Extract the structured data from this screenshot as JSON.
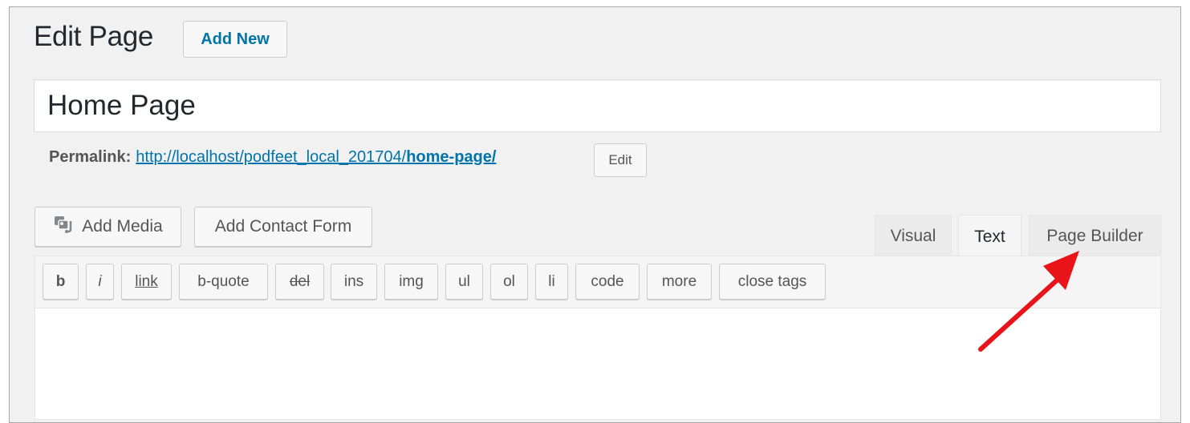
{
  "header": {
    "title": "Edit Page",
    "add_new": "Add New"
  },
  "post": {
    "title": "Home Page"
  },
  "permalink": {
    "label": "Permalink:",
    "url_base": "http://localhost/podfeet_local_201704/",
    "url_slug": "home-page/",
    "edit_label": "Edit"
  },
  "media": {
    "add_media": "Add Media",
    "add_contact_form": "Add Contact Form"
  },
  "tabs": [
    {
      "label": "Visual",
      "active": false
    },
    {
      "label": "Text",
      "active": true
    },
    {
      "label": "Page Builder",
      "active": false
    }
  ],
  "quicktags": [
    "b",
    "i",
    "link",
    "b-quote",
    "del",
    "ins",
    "img",
    "ul",
    "ol",
    "li",
    "code",
    "more",
    "close tags"
  ],
  "colors": {
    "link": "#0073aa",
    "annotation_arrow": "#e8141a",
    "background": "#f1f1f1"
  },
  "icons": {
    "add_media": "media-icon"
  }
}
